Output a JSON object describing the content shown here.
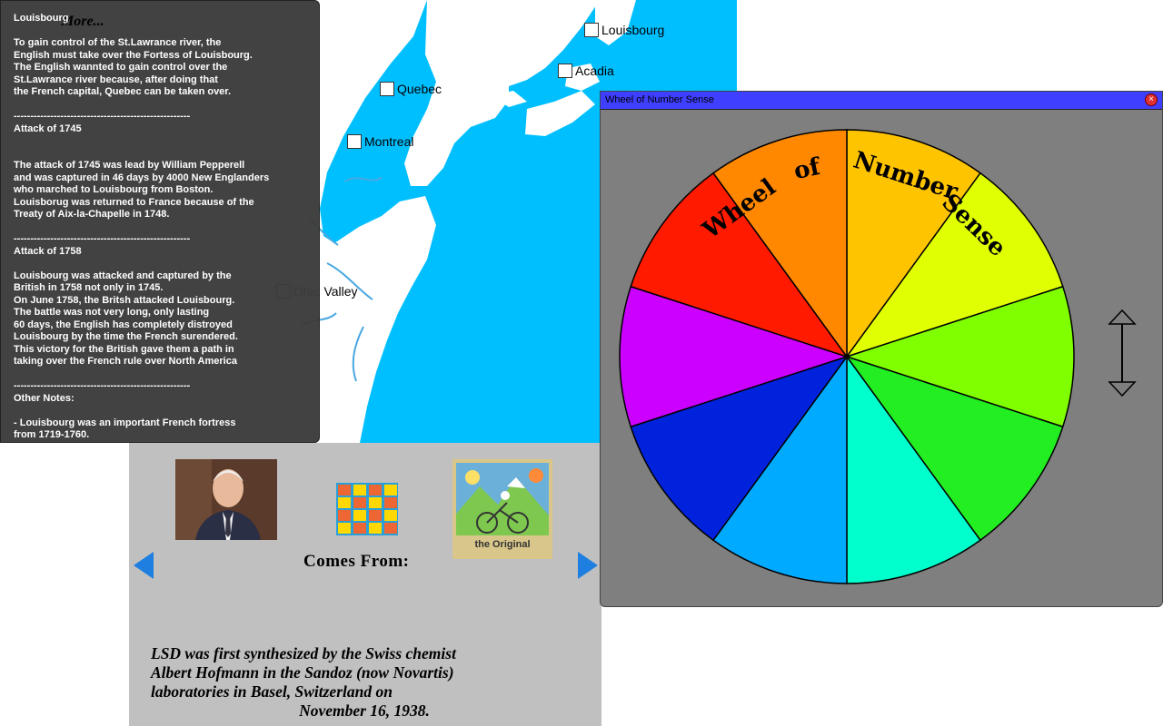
{
  "map": {
    "locations": [
      {
        "label": "Louisbourg"
      },
      {
        "label": "Acadia"
      },
      {
        "label": "Quebec"
      },
      {
        "label": "Montreal"
      },
      {
        "label": "Ohio Valley"
      }
    ],
    "colors": {
      "water": "#00bfff",
      "land": "#ffffff"
    }
  },
  "notes": {
    "more_label": "More...",
    "text": "Louisbourg\n\nTo gain control of the St.Lawrance river, the\nEnglish must take over the Fortess of Louisbourg.\nThe English wannted to gain control over the\nSt.Lawrance river because, after doing that\nthe French capital, Quebec can be taken over.\n\n-----------------------------------------------------\nAttack of 1745\n\n\nThe attack of 1745 was lead by William Pepperell\nand was captured in 46 days by 4000 New Englanders\nwho marched to Louisbourg from Boston.\nLouisborug was returned to France because of the\nTreaty of Aix-la-Chapelle in 1748.\n\n-----------------------------------------------------\nAttack of 1758\n\nLouisbourg was attacked and captured by the\nBritish in 1758 not only in 1745.\nOn June 1758, the Britsh attacked Louisbourg.\nThe battle was not very long, only lasting\n60 days, the English has completely distroyed\nLouisbourg by the time the French surendered.\nThis victory for the British gave them a path in\ntaking over the French rule over North America\n\n-----------------------------------------------------\nOther Notes:\n\n- Louisbourg was an important French fortress\nfrom 1719-1760."
  },
  "lsd": {
    "comes_from": "Comes From:",
    "text_lines": [
      "LSD was first synthesized by the Swiss chemist",
      "Albert Hofmann in the Sandoz (now Novartis)",
      "laboratories in Basel, Switzerland on",
      "November 16, 1938."
    ],
    "blotter_caption": "the Original",
    "colors": {
      "panel": "#c0c0c0",
      "arrow": "#1e7fe0"
    }
  },
  "wheel_window": {
    "title": "Wheel of Number Sense",
    "close_glyph": "×",
    "wheel_words": [
      "Wheel",
      "of",
      "Number",
      "Sense"
    ],
    "segment_colors": [
      "#ffc400",
      "#e0ff00",
      "#80ff00",
      "#22ee22",
      "#00ffcc",
      "#00aaff",
      "#0022dd",
      "#cc00ff",
      "#ff1a00",
      "#ff8800"
    ],
    "colors": {
      "title_bar": "#3f3fff",
      "window": "#7f7f7f"
    }
  }
}
